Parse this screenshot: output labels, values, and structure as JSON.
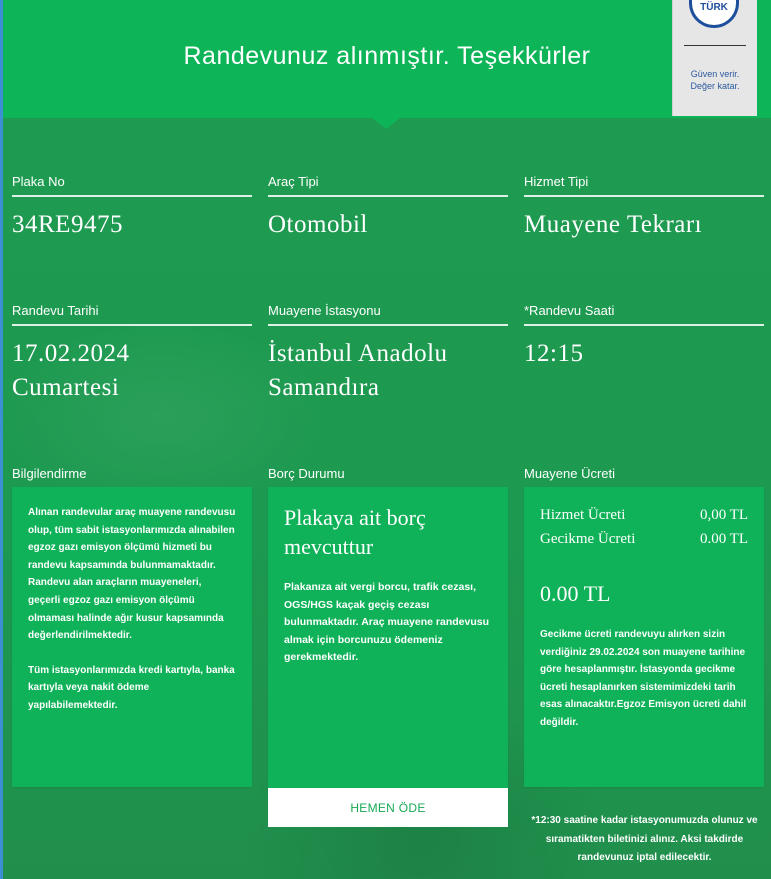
{
  "header": {
    "title": "Randevunuz alınmıştır. Teşekkürler",
    "logo": {
      "brand": "TÜRK",
      "slogan_line1": "Güven verir.",
      "slogan_line2": "Değer katar."
    }
  },
  "fields": {
    "plate": {
      "label": "Plaka No",
      "value": "34RE9475"
    },
    "vehicle_type": {
      "label": "Araç Tipi",
      "value": "Otomobil"
    },
    "service_type": {
      "label": "Hizmet Tipi",
      "value": "Muayene Tekrarı"
    },
    "date": {
      "label": "Randevu Tarihi",
      "value_line1": "17.02.2024",
      "value_line2": "Cumartesi"
    },
    "station": {
      "label": "Muayene İstasyonu",
      "value_line1": "İstanbul Anadolu",
      "value_line2": "Samandıra"
    },
    "time": {
      "label": "*Randevu Saati",
      "value": "12:15"
    }
  },
  "info": {
    "label": "Bilgilendirme",
    "paragraph1": "Alınan randevular araç muayene randevusu olup, tüm sabit istasyonlarımızda alınabilen egzoz gazı emisyon ölçümü hizmeti bu randevu kapsamında bulunmamaktadır. Randevu alan araçların muayeneleri, geçerli egzoz gazı emisyon ölçümü olmaması halinde ağır kusur kapsamında değerlendirilmektedir.",
    "paragraph2": "Tüm istasyonlarımızda kredi kartıyla, banka kartıyla veya nakit ödeme yapılabilemektedir."
  },
  "debt": {
    "label": "Borç Durumu",
    "title": "Plakaya ait borç mevcuttur",
    "text": "Plakanıza ait vergi borcu, trafik cezası, OGS/HGS kaçak geçiş cezası bulunmaktadır. Araç muayene randevusu almak için borcunuzu ödemeniz gerekmektedir.",
    "pay_button": "HEMEN ÖDE"
  },
  "fee": {
    "label": "Muayene Ücreti",
    "service_fee_label": "Hizmet Ücreti",
    "service_fee_value": "0,00 TL",
    "late_fee_label": "Gecikme Ücreti",
    "late_fee_value": "0.00 TL",
    "total": "0.00 TL",
    "note": "Gecikme ücreti randevuyu alırken sizin verdiğiniz 29.02.2024 son muayene tarihine göre hesaplanmıştır. İstasyonda gecikme ücreti hesaplanırken sistemimizdeki tarih esas alınacaktır.Egzoz Emisyon ücreti dahil değildir."
  },
  "footer_note": "*12:30 saatine kadar istasyonumuzda olunuz ve sıramatikten biletinizi alınız. Aksi takdirde randevunuz iptal edilecektir.",
  "colors": {
    "header_green": "#0eb458",
    "background_green": "#1f9a52",
    "card_green": "#0fb258",
    "logo_blue": "#1e4f9c"
  }
}
